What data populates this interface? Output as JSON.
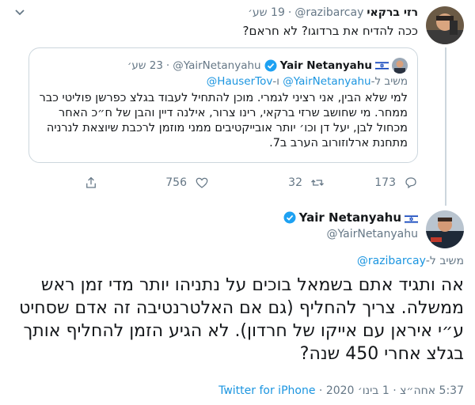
{
  "parent_tweet": {
    "display_name": "רזי ברקאי",
    "handle": "@razibarcay",
    "separator": "·",
    "time": "19 שע׳",
    "text": "ככה להדיח את ברדוגו? לא חראם?"
  },
  "quoted_tweet": {
    "display_name": "Yair Netanyahu",
    "handle": "@YairNetanyahu",
    "separator": "·",
    "time": "23 שע׳",
    "reply_prefix": "משיב ל-",
    "reply_to_1": "@YairNetanyahu",
    "reply_and": " ו-",
    "reply_to_2": "@HauserTov",
    "text": "למי שלא הבין, אני רציני לגמרי. מוכן להתחיל לעבוד בגלצ כפרשן פוליטי כבר ממחר. מי שחושב שרזי ברקאי, רינו צרור, אילנה דיין והבן של ח״כ האחר מכחול לבן, יעל דן וכו׳ יותר אובייקטיבים ממני מוזמן לרכבת שיוצאת לנרניה מתחנת ארלוזורוב הערב ב7."
  },
  "actions": {
    "reply_count": "173",
    "retweet_count": "32",
    "like_count": "756",
    "share_count": ""
  },
  "main_tweet": {
    "display_name": "Yair Netanyahu",
    "handle": "@YairNetanyahu",
    "reply_prefix": "משיב ל-",
    "reply_to": "@razibarcay",
    "text": "אה ותגיד אתם בשמאל בוכים על נתניהו יותר מדי זמן ראש ממשלה. צריך להחליף (גם אם האלטרנטיבה זה אדם שסחיט ע״י איראן עם אייקו של חרדון). לא הגיע הזמן להחליף אותך בגלצ אחרי 450 שנה?",
    "time": "5:37 אחה״צ",
    "separator_1": "·",
    "date": "1 בינו׳ 2020",
    "separator_2": "·",
    "source": "Twitter for iPhone"
  },
  "colors": {
    "link": "#1b95e0",
    "muted": "#657786",
    "border": "#ccd6dd",
    "verified": "#1da1f2"
  },
  "icons": [
    "chevron-down-icon",
    "verified-badge-icon",
    "israel-flag-icon",
    "reply-icon",
    "retweet-icon",
    "like-icon",
    "share-icon"
  ]
}
